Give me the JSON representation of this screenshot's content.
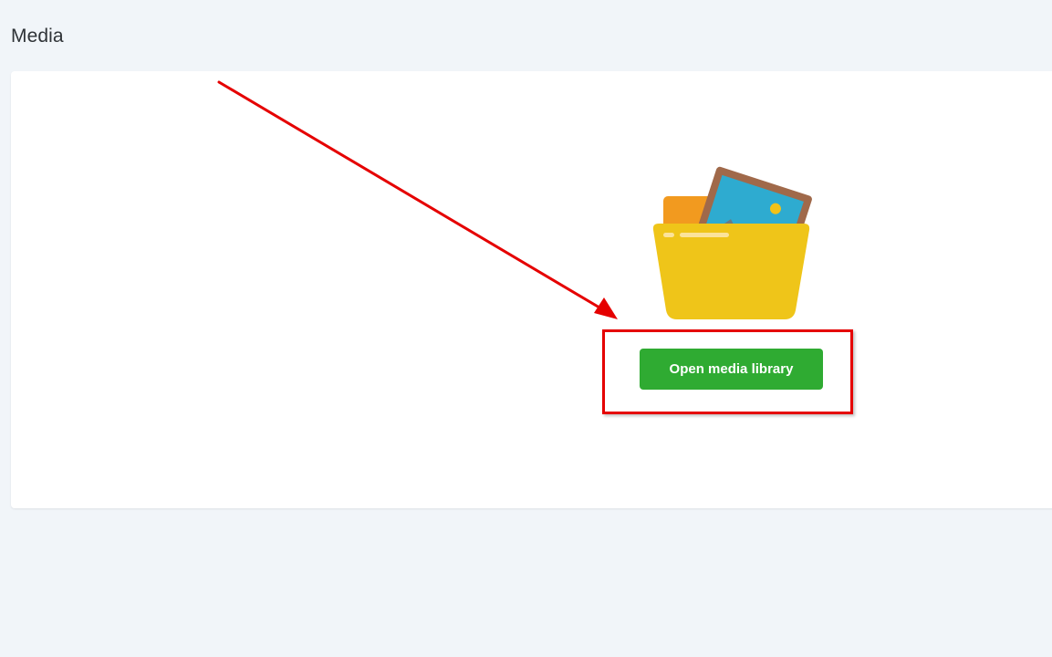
{
  "page": {
    "title": "Media"
  },
  "media_panel": {
    "illustration_icon": "folder-with-picture-icon",
    "open_button_label": "Open media library",
    "button_color": "#2fab32"
  },
  "annotations": {
    "highlight_color": "#e50000"
  }
}
